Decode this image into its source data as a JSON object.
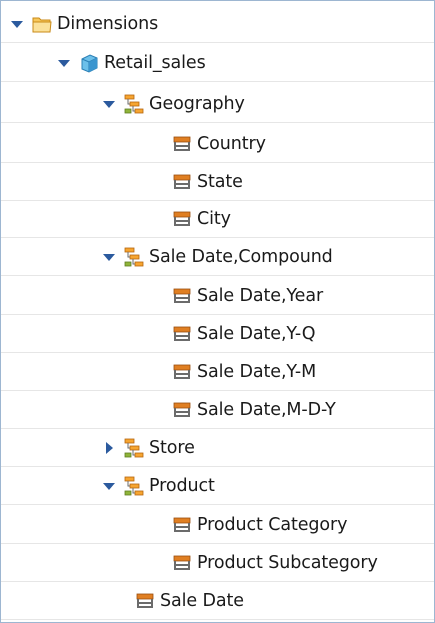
{
  "tree": {
    "dimensions": {
      "label": "Dimensions",
      "icon": "folder-icon",
      "expanded": true
    },
    "retail_sales": {
      "label": "Retail_sales",
      "icon": "cube-icon",
      "expanded": true
    },
    "geography": {
      "label": "Geography",
      "icon": "hierarchy-icon",
      "expanded": true
    },
    "country": {
      "label": "Country",
      "icon": "level-icon"
    },
    "state": {
      "label": "State",
      "icon": "level-icon"
    },
    "city": {
      "label": "City",
      "icon": "level-icon"
    },
    "sale_date_compound": {
      "label": "Sale Date,Compound",
      "icon": "hierarchy-icon",
      "expanded": true
    },
    "sale_date_year": {
      "label": "Sale Date,Year",
      "icon": "level-icon"
    },
    "sale_date_yq": {
      "label": "Sale Date,Y-Q",
      "icon": "level-icon"
    },
    "sale_date_ym": {
      "label": "Sale Date,Y-M",
      "icon": "level-icon"
    },
    "sale_date_mdy": {
      "label": "Sale Date,M-D-Y",
      "icon": "level-icon"
    },
    "store": {
      "label": "Store",
      "icon": "hierarchy-icon",
      "expanded": false
    },
    "product": {
      "label": "Product",
      "icon": "hierarchy-icon",
      "expanded": true
    },
    "product_category": {
      "label": "Product Category",
      "icon": "level-icon"
    },
    "product_subcategory": {
      "label": "Product Subcategory",
      "icon": "level-icon"
    },
    "sale_date": {
      "label": "Sale Date",
      "icon": "level-icon"
    }
  },
  "colors": {
    "border": "#9db6d1",
    "arrow": "#2b5a9e",
    "folder": "#f2b43a",
    "cube": "#4aa3d8",
    "hierarchy": "#d07a14",
    "level": "#c0661a"
  }
}
